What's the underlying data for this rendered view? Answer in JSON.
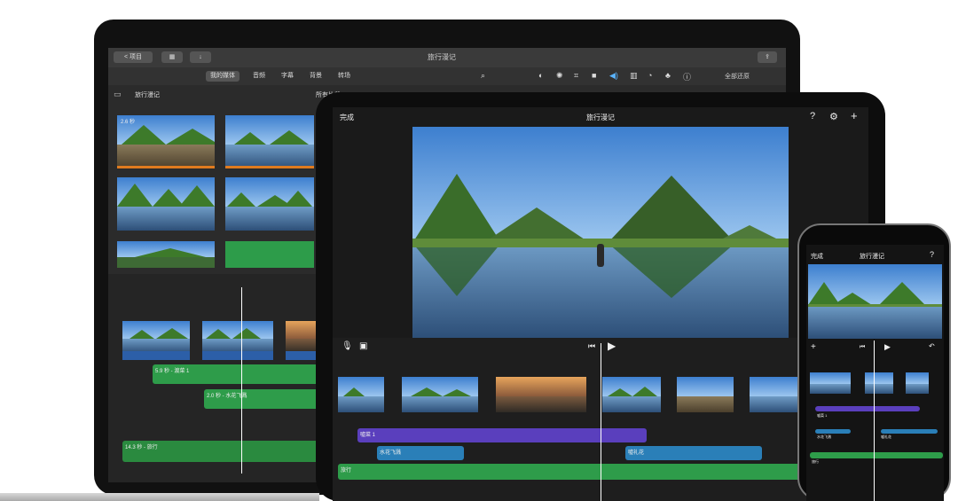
{
  "mac": {
    "title": "旅行漫记",
    "back_label": "< 项目",
    "tabs": [
      {
        "label": "我的媒体",
        "active": true
      },
      {
        "label": "音频",
        "active": false
      },
      {
        "label": "字幕",
        "active": false
      },
      {
        "label": "背景",
        "active": false
      },
      {
        "label": "转场",
        "active": false
      }
    ],
    "library_title": "旅行漫记",
    "library_filter": "所有片段",
    "reset_all": "全部还原",
    "first_clip_duration": "2.6 秒",
    "audio_clips": [
      {
        "label": "5.9 秒 - 渡菜 1"
      },
      {
        "label": "2.0 秒 - 水花飞溅"
      },
      {
        "label": "14.3 秒 - 旅行"
      }
    ]
  },
  "ipad": {
    "done": "完成",
    "title": "旅行漫记",
    "audio_clips": [
      {
        "label": "嘘菜 1"
      },
      {
        "label": "水花飞溅"
      },
      {
        "label": "嘘礼花"
      },
      {
        "label": "旅行"
      }
    ]
  },
  "iphone": {
    "done": "完成",
    "title": "旅行漫记",
    "audio_clips": [
      {
        "label": "嘘菜 1"
      },
      {
        "label": "水花飞溅"
      },
      {
        "label": "嘘礼花"
      },
      {
        "label": "旅行"
      }
    ]
  },
  "colors": {
    "accent_blue": "#2c5fa8",
    "audio_green": "#2e9c4a",
    "sound_purple": "#5a3fbd",
    "effect_teal": "#2a7fb8"
  }
}
